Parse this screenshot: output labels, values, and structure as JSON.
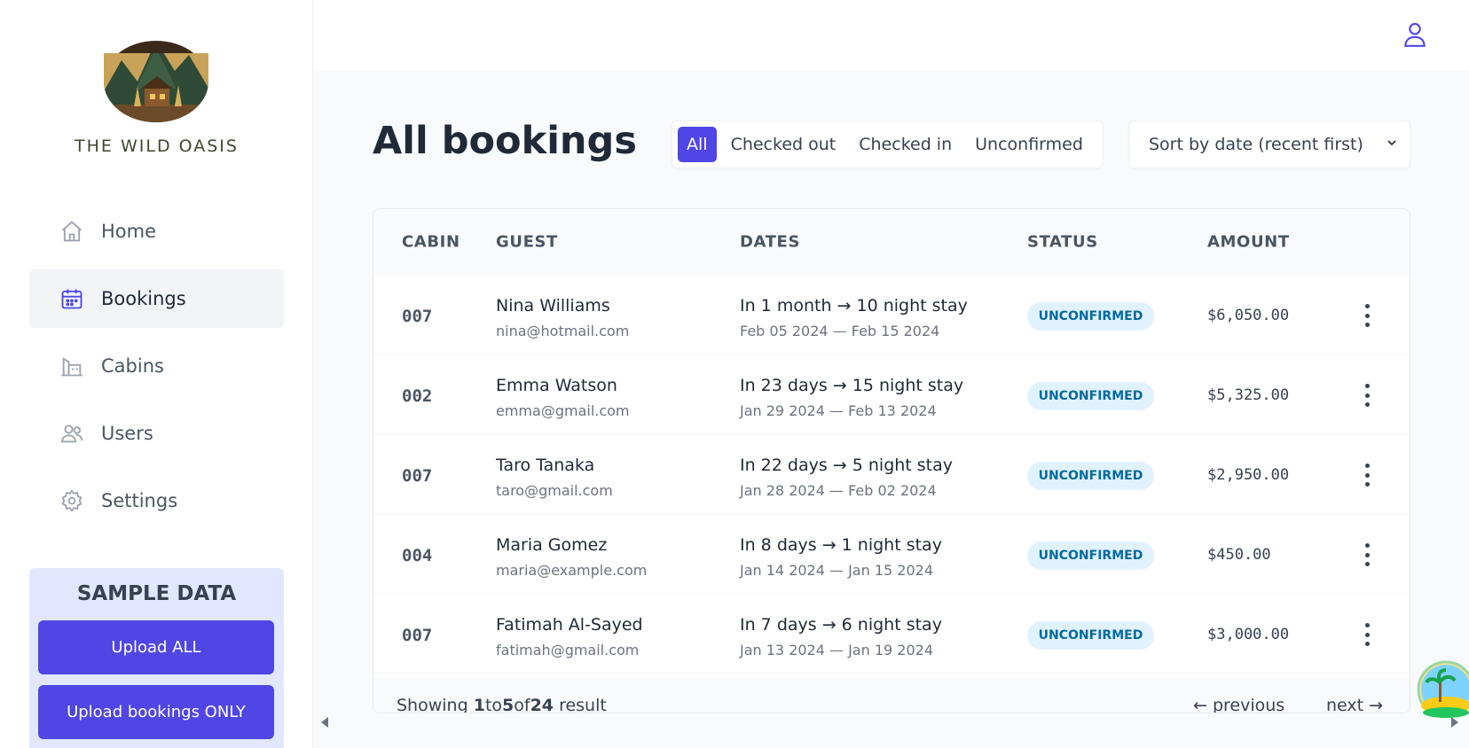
{
  "brand": {
    "name": "THE WILD OASIS"
  },
  "sidebar": {
    "items": [
      {
        "label": "Home",
        "icon": "home-icon"
      },
      {
        "label": "Bookings",
        "icon": "calendar-icon"
      },
      {
        "label": "Cabins",
        "icon": "cabins-icon"
      },
      {
        "label": "Users",
        "icon": "users-icon"
      },
      {
        "label": "Settings",
        "icon": "gear-icon"
      }
    ],
    "active": "Bookings"
  },
  "sample_data": {
    "title": "SAMPLE DATA",
    "upload_all": "Upload ALL",
    "upload_bookings": "Upload bookings ONLY"
  },
  "page": {
    "title": "All bookings",
    "filters": [
      "All",
      "Checked out",
      "Checked in",
      "Unconfirmed"
    ],
    "active_filter": "All",
    "sort": {
      "selected": "Sort by date (recent first)"
    }
  },
  "table": {
    "headers": [
      "CABIN",
      "GUEST",
      "DATES",
      "STATUS",
      "AMOUNT"
    ],
    "rows": [
      {
        "cabin": "007",
        "guest": "Nina Williams",
        "email": "nina@hotmail.com",
        "when": "In 1 month → 10 night stay",
        "range": "Feb 05 2024 — Feb 15 2024",
        "status": "UNCONFIRMED",
        "amount": "$6,050.00"
      },
      {
        "cabin": "002",
        "guest": "Emma Watson",
        "email": "emma@gmail.com",
        "when": "In 23 days → 15 night stay",
        "range": "Jan 29 2024 — Feb 13 2024",
        "status": "UNCONFIRMED",
        "amount": "$5,325.00"
      },
      {
        "cabin": "007",
        "guest": "Taro Tanaka",
        "email": "taro@gmail.com",
        "when": "In 22 days → 5 night stay",
        "range": "Jan 28 2024 — Feb 02 2024",
        "status": "UNCONFIRMED",
        "amount": "$2,950.00"
      },
      {
        "cabin": "004",
        "guest": "Maria Gomez",
        "email": "maria@example.com",
        "when": "In 8 days → 1 night stay",
        "range": "Jan 14 2024 — Jan 15 2024",
        "status": "UNCONFIRMED",
        "amount": "$450.00"
      },
      {
        "cabin": "007",
        "guest": "Fatimah Al-Sayed",
        "email": "fatimah@gmail.com",
        "when": "In 7 days → 6 night stay",
        "range": "Jan 13 2024 — Jan 19 2024",
        "status": "UNCONFIRMED",
        "amount": "$3,000.00"
      }
    ],
    "footer": {
      "showing_prefix": "Showing",
      "from": "1",
      "to_word": "to",
      "to": "5",
      "of_word": "of",
      "total": "24",
      "suffix": "result",
      "previous": "← previous",
      "next": "next →"
    }
  },
  "colors": {
    "accent": "#4f46e5",
    "status_bg": "#e0f2fe",
    "status_text": "#0369a1"
  }
}
